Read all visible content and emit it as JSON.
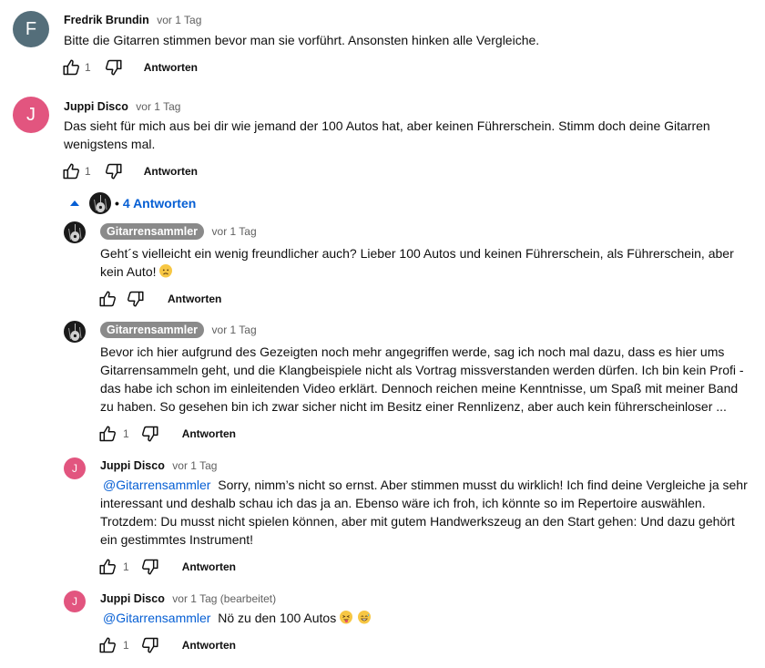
{
  "comments": [
    {
      "avatar_letter": "F",
      "avatar_color": "#546e7a",
      "author": "Fredrik Brundin",
      "time": "vor 1 Tag",
      "text": "Bitte die Gitarren stimmen bevor man sie vorführt. Ansonsten hinken alle Vergleiche.",
      "likes": "1",
      "reply_label": "Antworten"
    },
    {
      "avatar_letter": "J",
      "avatar_color": "#e2557f",
      "author": "Juppi Disco",
      "time": "vor 1 Tag",
      "text": "Das sieht für mich aus bei dir wie jemand der 100 Autos hat, aber keinen Führerschein. Stimm doch deine Gitarren wenigstens mal.",
      "likes": "1",
      "reply_label": "Antworten"
    }
  ],
  "replies_toggle": {
    "label": "4 Antworten",
    "separator": "•"
  },
  "replies": [
    {
      "author": "Gitarrensammler",
      "time": "vor 1 Tag",
      "text": "Geht´s vielleicht ein wenig freundlicher auch? Lieber 100 Autos und keinen Führerschein, als Führerschein, aber kein Auto!",
      "emoji": "slightly-frowning-face",
      "likes": "",
      "reply_label": "Antworten"
    },
    {
      "author": "Gitarrensammler",
      "time": "vor 1 Tag",
      "text": "Bevor ich hier aufgrund des Gezeigten noch mehr angegriffen werde, sag ich noch mal dazu, dass es hier ums Gitarrensammeln geht, und die Klangbeispiele nicht als Vortrag missverstanden werden dürfen. Ich bin kein Profi - das habe ich schon im einleitenden Video erklärt. Dennoch reichen meine Kenntnisse, um Spaß mit meiner Band zu haben. So gesehen bin ich zwar sicher nicht im Besitz einer Rennlizenz, aber auch kein führerscheinloser ...",
      "likes": "1",
      "reply_label": "Antworten"
    },
    {
      "avatar_letter": "J",
      "avatar_color": "#e2557f",
      "author": "Juppi Disco",
      "time": "vor 1 Tag",
      "mention": "@Gitarrensammler",
      "text": "Sorry, nimm’s nicht so ernst. Aber stimmen musst du wirklich! Ich find deine Vergleiche ja sehr interessant und deshalb schau ich das ja an. Ebenso wäre ich froh, ich könnte so im Repertoire auswählen. Trotzdem: Du musst nicht spielen können, aber mit gutem Handwerkszeug an den Start gehen: Und dazu gehört ein gestimmtes Instrument!",
      "likes": "1",
      "reply_label": "Antworten"
    },
    {
      "avatar_letter": "J",
      "avatar_color": "#e2557f",
      "author": "Juppi Disco",
      "time": "vor 1 Tag (bearbeitet)",
      "mention": "@Gitarrensammler",
      "text": "Nö zu den 100 Autos",
      "emojis": [
        "squinting-face-with-tongue",
        "grinning-face-with-sweat"
      ],
      "likes": "1",
      "reply_label": "Antworten"
    }
  ],
  "icons": {
    "like": "thumbs-up-icon",
    "dislike": "thumbs-down-icon",
    "collapse": "caret-up-icon"
  },
  "colors": {
    "link_blue": "#065fd4",
    "muted": "#606060",
    "creator_pill": "#8a8a8a"
  }
}
